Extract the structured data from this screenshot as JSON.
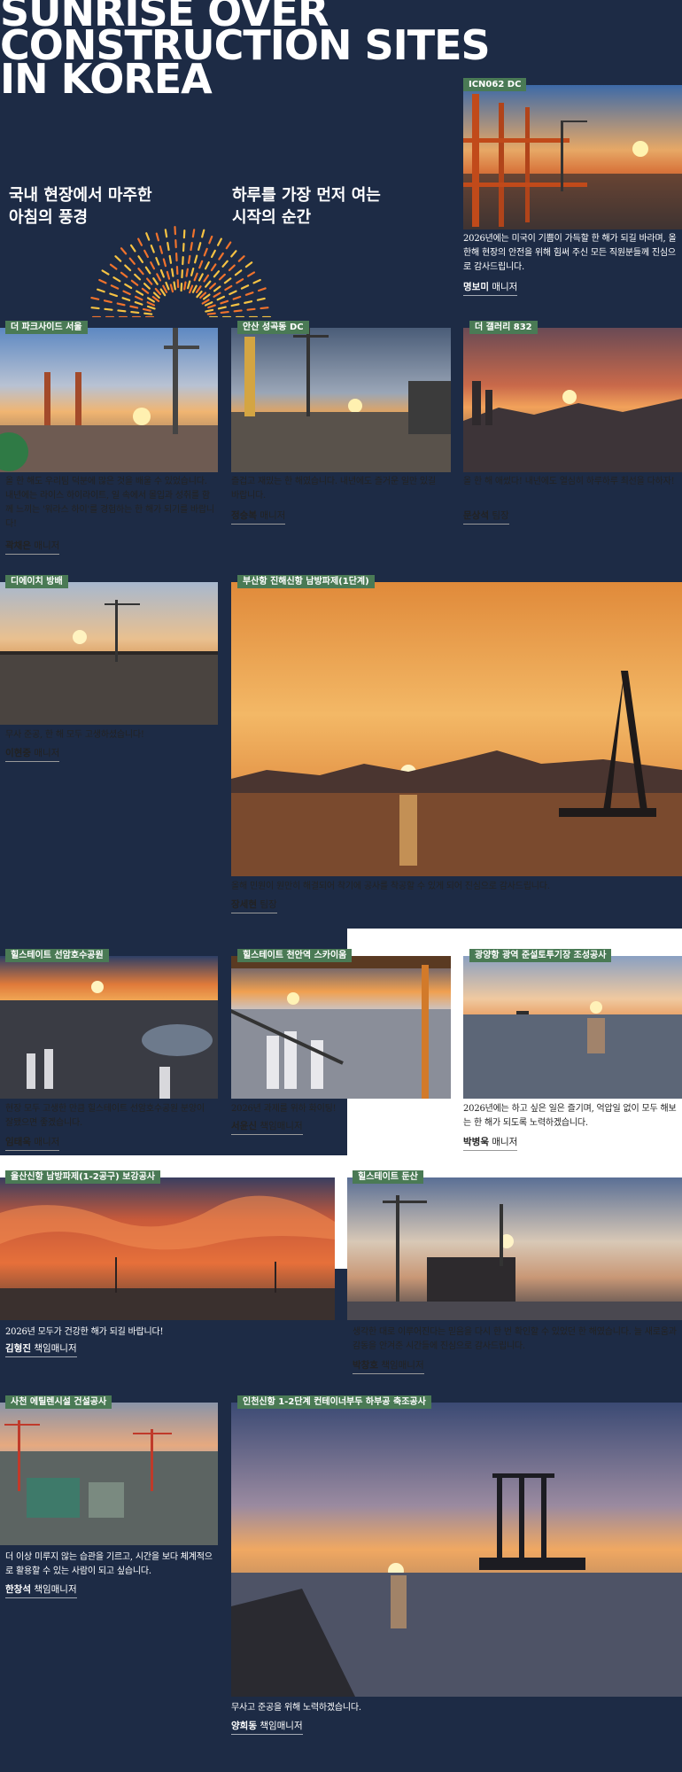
{
  "title": "SUNRISE OVER CONSTRUCTION SITES IN KOREA",
  "subheads": {
    "left": "국내 현장에서 마주한\n아침의 풍경",
    "right": "하루를 가장 먼저 여는\n시작의 순간"
  },
  "colors": {
    "navy": "#1d2b45",
    "tag_green": "#4a7a55",
    "sunburst_orange": "#f0722c",
    "sunburst_yellow": "#f6c343"
  },
  "cards": [
    {
      "tag": "ICN062 DC",
      "caption": "2026년에는 미국이 기쁨이 가득할 한 해가 되길 바라며, 올 한해 현장의 안전을 위해 힘써 주신 모든 직원분들께 진심으로 감사드립니다.",
      "author_name": "명보미",
      "author_role": "매니저"
    },
    {
      "tag": "더 파크사이드 서울",
      "caption": "올 한 해도 우리팀 덕분에 많은 것을 배울 수 있었습니다. 내년에는 라이스 하이라이트, 일 속에서 몰입과 성취를 함께 느끼는 '워라스 하이'를 경험하는 한 해가 되기를 바랍니다!",
      "author_name": "곽채은",
      "author_role": "매니저"
    },
    {
      "tag": "안산 성곡동 DC",
      "caption": "즐겁고 재밌는 한 해였습니다. 내년에도 즐거운 일만 있길 바랍니다.",
      "author_name": "정승복",
      "author_role": "매니저"
    },
    {
      "tag": "더 갤러리 832",
      "caption": "올 한 해 애썼다! 내년에도 열심히 하루하루 최선을 다하자!",
      "author_name": "문상석",
      "author_role": "팀장"
    },
    {
      "tag": "디에이치 방배",
      "caption": "무사 준공, 한 해 모두 고생하셨습니다!",
      "author_name": "이현중",
      "author_role": "매니저"
    },
    {
      "tag": "부산항 진해신항 남방파제(1단계)",
      "caption": "올해 민원이 원만히 해결되어 착기에 공사를 착공할 수 있게 되어 진심으로 감사드립니다.",
      "author_name": "장세현",
      "author_role": "팀장"
    },
    {
      "tag": "힐스테이트 선암호수공원",
      "caption": "현장 모두 고생한 만큼 힐스테이트 선암호수공원 분양이 잘됐으면 좋겠습니다.",
      "author_name": "임태욱",
      "author_role": "매니저"
    },
    {
      "tag": "힐스테이트 천안역 스카이움",
      "caption": "2026년 과제를 위하 화이팅!",
      "author_name": "서윤신",
      "author_role": "책임매니저"
    },
    {
      "tag": "광양항 광역 준설토투기장 조성공사",
      "caption": "2026년에는 하고 싶은 일은 즐기며, 억압일 없이 모두 해보는 한 해가 되도록 노력하겠습니다.",
      "author_name": "박병욱",
      "author_role": "매니저"
    },
    {
      "tag": "울산신항 남방파제(1-2공구) 보강공사",
      "caption": "2026년 모두가 건강한 해가 되길 바랍니다!",
      "author_name": "김형진",
      "author_role": "책임매니저"
    },
    {
      "tag": "힐스테이트 둔산",
      "caption": "생각한 대로 이루어진다는 믿음을 다시 한 번 확인할 수 있었던 한 해였습니다. 늘 새로움과 감동을 안겨준 시간들에 진심으로 감사드립니다.",
      "author_name": "박창호",
      "author_role": "책임매니저"
    },
    {
      "tag": "사천 에틸렌시설 건설공사",
      "caption": "더 이상 미루지 않는 습관을 기르고, 시간을 보다 체계적으로 활용할 수 있는 사람이 되고 싶습니다.",
      "author_name": "한창석",
      "author_role": "책임매니저"
    },
    {
      "tag": "인천신항 1-2단계 컨테이너부두 하부공 축조공사",
      "caption": "무사고 준공을 위해 노력하겠습니다.",
      "author_name": "양희동",
      "author_role": "책임매니저"
    }
  ]
}
